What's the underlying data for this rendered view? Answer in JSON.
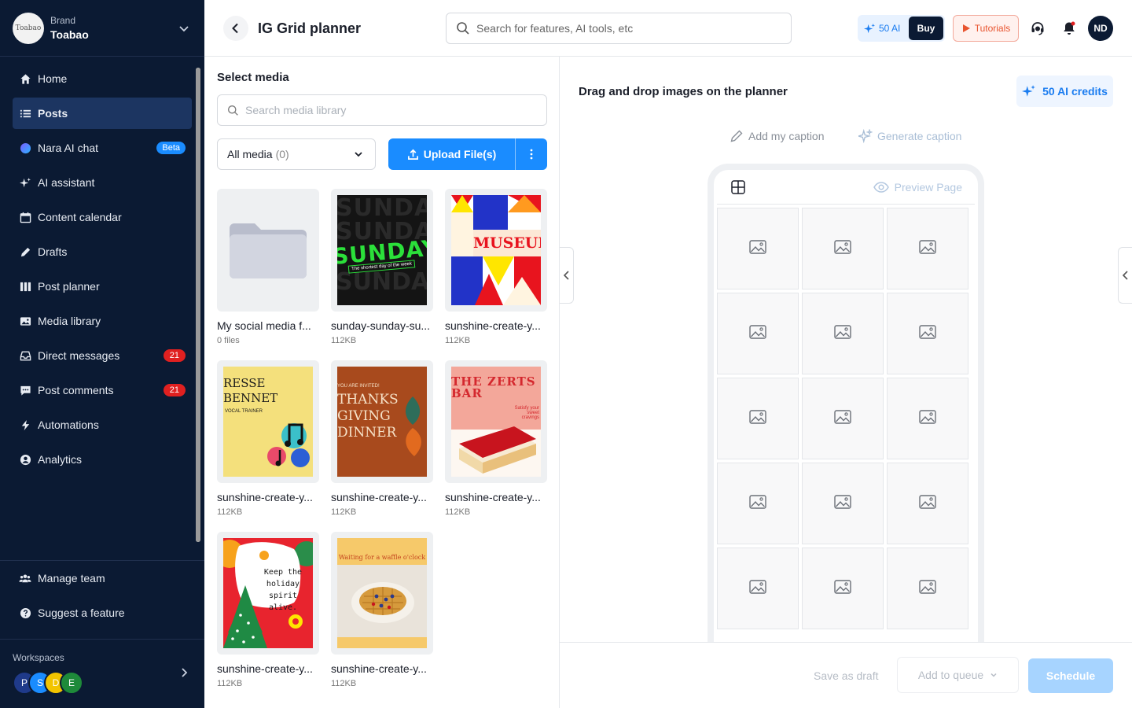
{
  "sidebar": {
    "brand_label": "Brand",
    "brand_name": "Toabao",
    "brand_logo_text": "Toabao",
    "items": [
      {
        "label": "Home",
        "icon": "home-icon"
      },
      {
        "label": "Posts",
        "icon": "list-icon",
        "active": true
      },
      {
        "label": "Nara AI chat",
        "icon": "nara-ai-icon",
        "badge": "Beta"
      },
      {
        "label": "AI assistant",
        "icon": "sparkle-icon"
      },
      {
        "label": "Content calendar",
        "icon": "calendar-icon"
      },
      {
        "label": "Drafts",
        "icon": "pencil-icon"
      },
      {
        "label": "Post planner",
        "icon": "columns-icon"
      },
      {
        "label": "Media library",
        "icon": "image-icon"
      },
      {
        "label": "Direct messages",
        "icon": "inbox-icon",
        "count": "21"
      },
      {
        "label": "Post comments",
        "icon": "comment-icon",
        "count": "21"
      },
      {
        "label": "Automations",
        "icon": "lightning-icon"
      },
      {
        "label": "Analytics",
        "icon": "user-circle-icon"
      }
    ],
    "bottom_items": [
      {
        "label": "Manage team",
        "icon": "team-icon"
      },
      {
        "label": "Suggest a feature",
        "icon": "question-icon"
      }
    ],
    "workspaces_label": "Workspaces",
    "workspaces": [
      {
        "letter": "P",
        "color": "#1f3a8a"
      },
      {
        "letter": "S",
        "color": "#1a8cff"
      },
      {
        "letter": "D",
        "color": "#f2c400"
      },
      {
        "letter": "E",
        "color": "#1e8a3a"
      }
    ]
  },
  "header": {
    "title": "IG Grid planner",
    "search_placeholder": "Search for features, AI tools, etc",
    "ai_credits": "50 AI",
    "buy_label": "Buy",
    "tutorials_label": "Tutorials",
    "user_initials": "ND"
  },
  "media": {
    "title": "Select media",
    "search_placeholder": "Search media library",
    "filter_label": "All media",
    "filter_count": "(0)",
    "upload_label": "Upload File(s)",
    "tiles": [
      {
        "name": "My social media f...",
        "meta": "0 files"
      },
      {
        "name": "sunday-sunday-su...",
        "meta": "112KB",
        "art_text": "SUNDAY",
        "art_sub": "The shortest day of the week"
      },
      {
        "name": "sunshine-create-y...",
        "meta": "112KB",
        "art_text": "MUSEUN"
      },
      {
        "name": "sunshine-create-y...",
        "meta": "112KB",
        "art_text": "RESSE BENNET",
        "art_sub": "VOCAL TRAINER"
      },
      {
        "name": "sunshine-create-y...",
        "meta": "112KB",
        "art_text": "THANKS GIVING DINNER",
        "art_sub": "YOU ARE INVITED!"
      },
      {
        "name": "sunshine-create-y...",
        "meta": "112KB",
        "art_text": "THE ZERTS BAR",
        "art_sub": "Satisfy your sweet cravings"
      },
      {
        "name": "sunshine-create-y...",
        "meta": "112KB",
        "art_text": "Keep the holiday spirit alive."
      },
      {
        "name": "sunshine-create-y...",
        "meta": "112KB",
        "art_text": "Waiting for a waffle o'clock"
      }
    ]
  },
  "planner": {
    "title": "Drag and drop images on the planner",
    "credits_label": "50 AI credits",
    "add_caption": "Add my caption",
    "generate_caption": "Generate caption",
    "preview_label": "Preview Page",
    "save_draft": "Save as draft",
    "add_queue": "Add to queue",
    "schedule": "Schedule"
  },
  "colors": {
    "sidebar_bg": "#0b1a33",
    "accent": "#1a8cff",
    "badge_red": "#e02020"
  }
}
